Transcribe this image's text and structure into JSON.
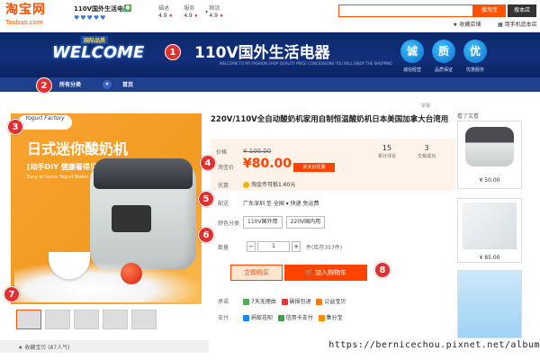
{
  "top": {
    "logo_cn": "淘宝网",
    "logo_en": "Taobao.com",
    "shop_name": "110V国外生活电器",
    "hearts": "♥♥♥♥♥",
    "ratings": [
      {
        "label": "描述",
        "value": "4.9"
      },
      {
        "label": "服务",
        "value": "4.9"
      },
      {
        "label": "物流",
        "value": "4.9"
      }
    ],
    "search_btn": "搜本店",
    "store_btn": "搜本店",
    "favorite": "收藏店铺",
    "phone": "用手机逛本店"
  },
  "banner": {
    "welcome": "WELCOME",
    "tag": "国际品质",
    "title": "110V国外生活电器",
    "subtitle": "WELCOME TO MY FASHION SHOP QUALITY PRICE CONCESSIONS YOU WILL ENJOY THE SHOPPING",
    "badges": [
      {
        "char": "诚",
        "label": "诚信经营"
      },
      {
        "char": "质",
        "label": "品质保证"
      },
      {
        "char": "优",
        "label": "优惠服务"
      }
    ]
  },
  "nav": {
    "category": "所有分类",
    "home": "首页"
  },
  "markers": [
    "1",
    "2",
    "3",
    "4",
    "5",
    "6",
    "7",
    "8"
  ],
  "image": {
    "badge": "Yogurt Factory",
    "headline": "日式迷你酸奶机",
    "sub": "[动手DIY 健康看得见]",
    "sub2": "Easy at home Yogurt Maker"
  },
  "product": {
    "report": "举报",
    "title": "220V/110V全自动酸奶机家用自制恒温酸奶机日本美国加拿大台湾用",
    "price_label": "价格",
    "orig_price": "¥ 100.00",
    "taobao_label": "淘宝价",
    "now_price": "¥80.00",
    "promo_tag": "步天价优惠",
    "reviews_count": "15",
    "reviews_label": "累计评论",
    "sales_count": "3",
    "sales_label": "交易成功",
    "promo_label": "优惠",
    "promo_text": "淘金币可抵1.60元",
    "ship_label": "配送",
    "ship_text": "广东深圳 至 全国 ▾   快递 免运费",
    "color_label": "颜色分类",
    "options": [
      "110V国外用",
      "220V国内用"
    ],
    "qty_label": "数量",
    "qty_value": "1",
    "stock": "件(库存357件)",
    "buy_now": "立即购买",
    "add_cart": "加入购物车",
    "promise_label": "承诺",
    "promises": [
      "7天无理由",
      "破损包退",
      "公益宝贝"
    ],
    "pay_label": "支付",
    "payments": [
      "蚂蚁花呗",
      "信用卡支付",
      "集分宝"
    ],
    "fav_bar": "收藏宝贝 (87人气)"
  },
  "sidebar": {
    "label": "看了又看",
    "items": [
      {
        "price": "¥ 50.00"
      },
      {
        "price": "¥ 85.00"
      },
      {
        "price": ""
      }
    ]
  },
  "watermark": "https://bernicechou.pixnet.net/album",
  "colors": {
    "accent": "#ff5000",
    "banner": "#0b2a6b",
    "marker": "#e03030",
    "price": "#ff4400"
  }
}
